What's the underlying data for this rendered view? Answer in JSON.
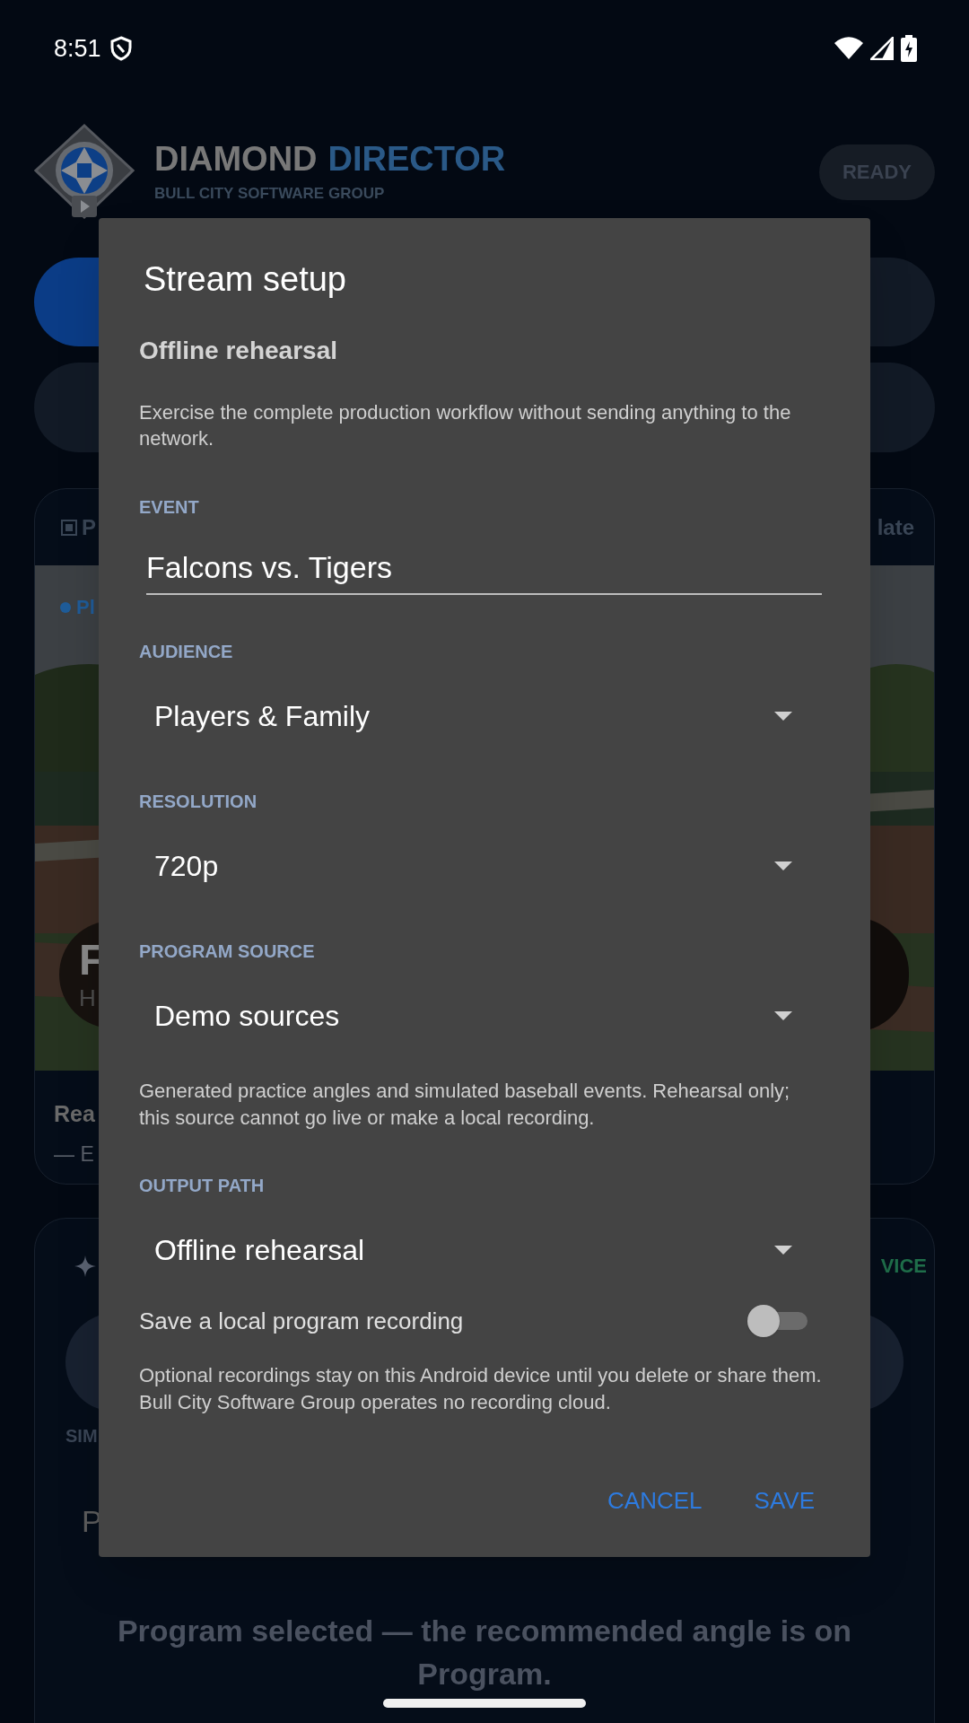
{
  "status_bar": {
    "time": "8:51"
  },
  "header": {
    "title_part1": "DIAMOND",
    "title_part2": "DIRECTOR",
    "subtitle": "BULL CITY SOFTWARE GROUP",
    "status_pill": "READY"
  },
  "preview_card": {
    "header_label": "P",
    "header_action": "late",
    "live_tag": "Pl",
    "overlay_title": "F",
    "overlay_subtitle": "H",
    "status_title": "Rea",
    "status_detail": "— E"
  },
  "assist_card": {
    "badge": "VICE",
    "section_label": "SIM",
    "row_text": "P",
    "footer_message": "Program selected — the recommended angle is on Program."
  },
  "dialog": {
    "title": "Stream setup",
    "mode_title": "Offline rehearsal",
    "mode_description": "Exercise the complete production workflow without sending anything to the network.",
    "fields": [
      {
        "kind": "text",
        "label": "EVENT",
        "value": "Falcons vs. Tigers"
      },
      {
        "kind": "dropdown",
        "label": "AUDIENCE",
        "value": "Players & Family"
      },
      {
        "kind": "dropdown",
        "label": "RESOLUTION",
        "value": "720p"
      },
      {
        "kind": "dropdown",
        "label": "PROGRAM SOURCE",
        "value": "Demo sources",
        "helper": "Generated practice angles and simulated baseball events. Rehearsal only; this source cannot go live or make a local recording."
      },
      {
        "kind": "dropdown",
        "label": "OUTPUT PATH",
        "value": "Offline rehearsal"
      }
    ],
    "switch": {
      "label": "Save a local program recording",
      "on": false
    },
    "note": "Optional recordings stay on this Android device until you delete or share them. Bull City Software Group operates no recording cloud.",
    "buttons": [
      "CANCEL",
      "SAVE"
    ]
  }
}
